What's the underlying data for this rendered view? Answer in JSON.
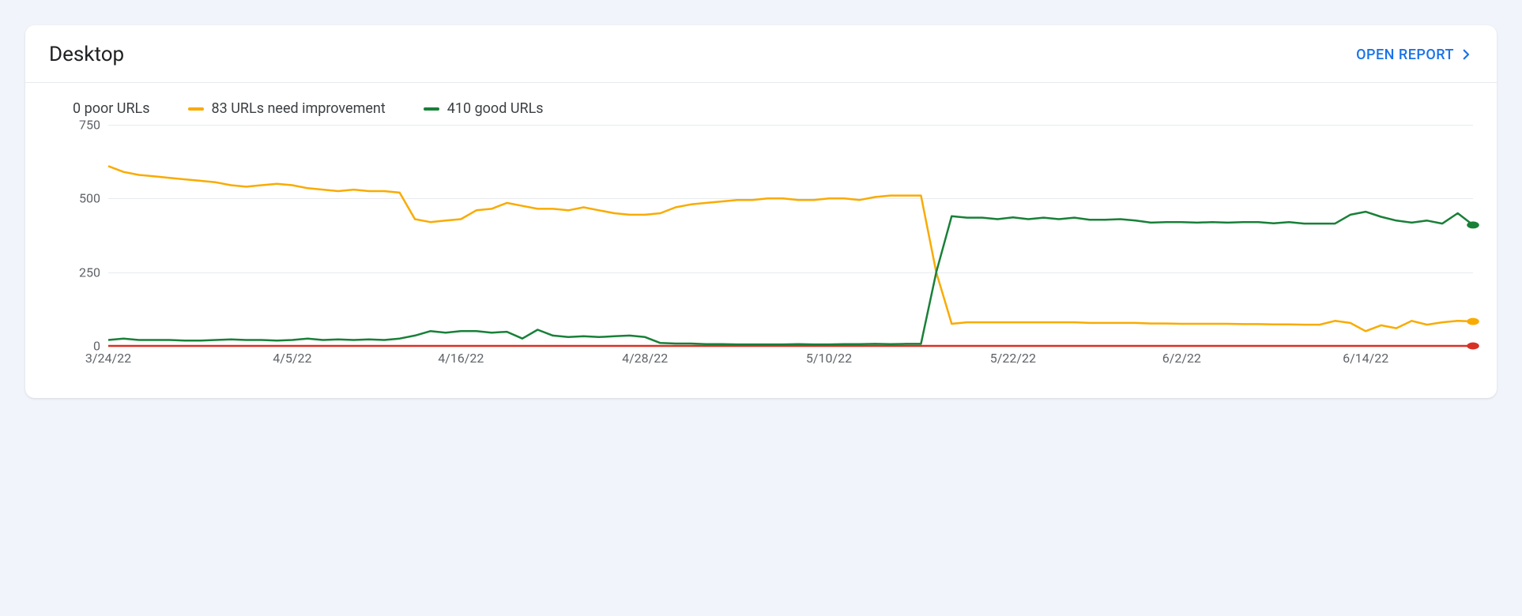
{
  "header": {
    "title": "Desktop",
    "open_report_label": "OPEN REPORT"
  },
  "legend": {
    "poor": {
      "label": "0 poor URLs",
      "color": "#d93025"
    },
    "needs": {
      "label": "83 URLs need improvement",
      "color": "#f9ab00"
    },
    "good": {
      "label": "410 good URLs",
      "color": "#188038"
    }
  },
  "chart_data": {
    "type": "line",
    "ylim": [
      0,
      750
    ],
    "y_ticks": [
      0,
      250,
      500,
      750
    ],
    "x_ticks": [
      "3/24/22",
      "4/5/22",
      "4/16/22",
      "4/28/22",
      "5/10/22",
      "5/22/22",
      "6/2/22",
      "6/14/22"
    ],
    "x": [
      "3/24/22",
      "3/25/22",
      "3/26/22",
      "3/27/22",
      "3/28/22",
      "3/29/22",
      "3/30/22",
      "3/31/22",
      "4/1/22",
      "4/2/22",
      "4/3/22",
      "4/4/22",
      "4/5/22",
      "4/6/22",
      "4/7/22",
      "4/8/22",
      "4/9/22",
      "4/10/22",
      "4/11/22",
      "4/12/22",
      "4/13/22",
      "4/14/22",
      "4/15/22",
      "4/16/22",
      "4/17/22",
      "4/18/22",
      "4/19/22",
      "4/20/22",
      "4/21/22",
      "4/22/22",
      "4/23/22",
      "4/24/22",
      "4/25/22",
      "4/26/22",
      "4/27/22",
      "4/28/22",
      "4/29/22",
      "4/30/22",
      "5/1/22",
      "5/2/22",
      "5/3/22",
      "5/4/22",
      "5/5/22",
      "5/6/22",
      "5/7/22",
      "5/8/22",
      "5/9/22",
      "5/10/22",
      "5/11/22",
      "5/12/22",
      "5/13/22",
      "5/14/22",
      "5/15/22",
      "5/16/22",
      "5/17/22",
      "5/18/22",
      "5/19/22",
      "5/20/22",
      "5/21/22",
      "5/22/22",
      "5/23/22",
      "5/24/22",
      "5/25/22",
      "5/26/22",
      "5/27/22",
      "5/28/22",
      "5/29/22",
      "5/30/22",
      "5/31/22",
      "6/1/22",
      "6/2/22",
      "6/3/22",
      "6/4/22",
      "6/5/22",
      "6/6/22",
      "6/7/22",
      "6/8/22",
      "6/9/22",
      "6/10/22",
      "6/11/22",
      "6/12/22",
      "6/13/22",
      "6/14/22",
      "6/15/22",
      "6/16/22",
      "6/17/22",
      "6/18/22",
      "6/19/22",
      "6/20/22",
      "6/21/22"
    ],
    "series": [
      {
        "name": "poor",
        "color": "#d93025",
        "values": [
          0,
          0,
          0,
          0,
          0,
          0,
          0,
          0,
          0,
          0,
          0,
          0,
          0,
          0,
          0,
          0,
          0,
          0,
          0,
          0,
          0,
          0,
          0,
          0,
          0,
          0,
          0,
          0,
          0,
          0,
          0,
          0,
          0,
          0,
          0,
          0,
          0,
          0,
          0,
          0,
          0,
          0,
          0,
          0,
          0,
          0,
          0,
          0,
          0,
          0,
          0,
          0,
          0,
          0,
          0,
          0,
          0,
          0,
          0,
          0,
          0,
          0,
          0,
          0,
          0,
          0,
          0,
          0,
          0,
          0,
          0,
          0,
          0,
          0,
          0,
          0,
          0,
          0,
          0,
          0,
          0,
          0,
          0,
          0,
          0,
          0,
          0,
          0,
          0,
          0
        ]
      },
      {
        "name": "needs_improvement",
        "color": "#f9ab00",
        "values": [
          610,
          590,
          580,
          575,
          570,
          565,
          560,
          555,
          545,
          540,
          545,
          550,
          545,
          535,
          530,
          525,
          530,
          525,
          525,
          520,
          430,
          420,
          425,
          430,
          460,
          465,
          485,
          475,
          465,
          465,
          460,
          470,
          460,
          450,
          445,
          445,
          450,
          470,
          480,
          485,
          490,
          495,
          495,
          500,
          500,
          495,
          495,
          500,
          500,
          495,
          505,
          510,
          510,
          510,
          250,
          75,
          80,
          80,
          80,
          80,
          80,
          80,
          80,
          80,
          78,
          78,
          78,
          78,
          76,
          76,
          75,
          75,
          75,
          75,
          74,
          74,
          73,
          73,
          72,
          72,
          85,
          78,
          50,
          70,
          60,
          85,
          72,
          80,
          85,
          83
        ]
      },
      {
        "name": "good",
        "color": "#188038",
        "values": [
          20,
          25,
          20,
          20,
          20,
          18,
          18,
          20,
          22,
          20,
          20,
          18,
          20,
          25,
          20,
          22,
          20,
          22,
          20,
          25,
          35,
          50,
          45,
          50,
          50,
          45,
          48,
          25,
          55,
          35,
          30,
          33,
          30,
          33,
          35,
          30,
          10,
          8,
          8,
          6,
          6,
          5,
          5,
          5,
          5,
          6,
          5,
          5,
          6,
          6,
          7,
          6,
          7,
          7,
          250,
          440,
          435,
          435,
          430,
          436,
          430,
          435,
          430,
          435,
          428,
          428,
          430,
          425,
          418,
          420,
          420,
          418,
          420,
          418,
          420,
          420,
          416,
          420,
          415,
          415,
          415,
          445,
          455,
          438,
          425,
          418,
          425,
          415,
          450,
          410
        ]
      }
    ]
  }
}
